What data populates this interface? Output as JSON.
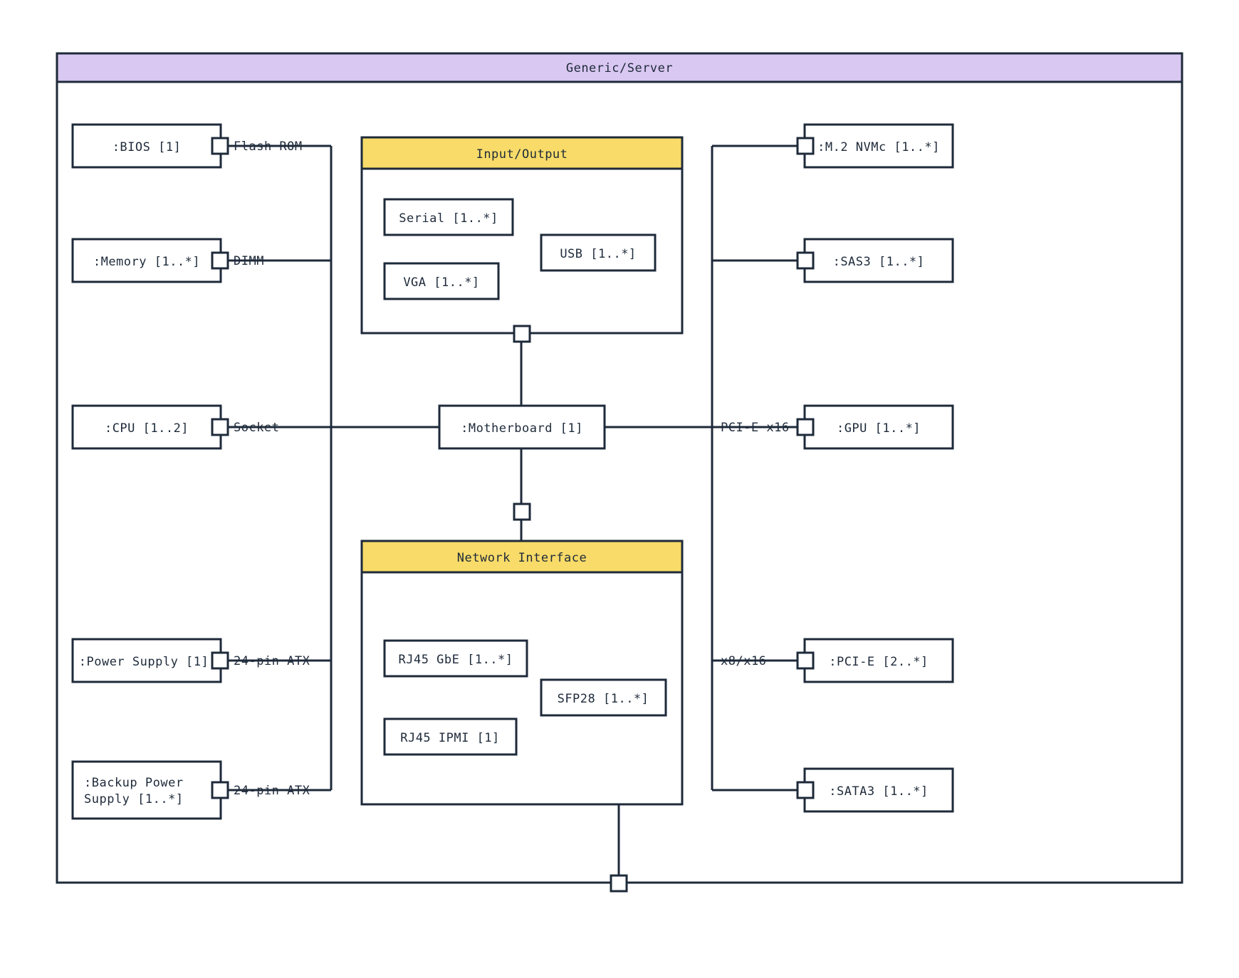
{
  "frame_title": "Generic/Server",
  "left": {
    "bios": ":BIOS [1]",
    "memory": ":Memory [1..*]",
    "cpu": ":CPU [1..2]",
    "psu": ":Power Supply [1]",
    "bpsu1": ":Backup Power",
    "bpsu2": "Supply [1..*]"
  },
  "right": {
    "m2": ":M.2 NVMc [1..*]",
    "sas3": ":SAS3 [1..*]",
    "gpu": ":GPU [1..*]",
    "pcie": ":PCI-E [2..*]",
    "sata3": ":SATA3 [1..*]"
  },
  "center": {
    "mobo": ":Motherboard [1]",
    "io_title": "Input/Output",
    "io": {
      "serial": "Serial [1..*]",
      "vga": "VGA [1..*]",
      "usb": "USB [1..*]"
    },
    "net_title": "Network Interface",
    "net": {
      "gbe": "RJ45 GbE [1..*]",
      "ipmi": "RJ45 IPMI [1]",
      "sfp": "SFP28 [1..*]"
    }
  },
  "edges": {
    "flash": "Flash ROM",
    "dimm": "DIMM",
    "socket": "Socket",
    "atx1": "24-pin ATX",
    "atx2": "24-pin ATX",
    "pciex16": "PCI-E x16",
    "x8x16": "x8/x16"
  }
}
